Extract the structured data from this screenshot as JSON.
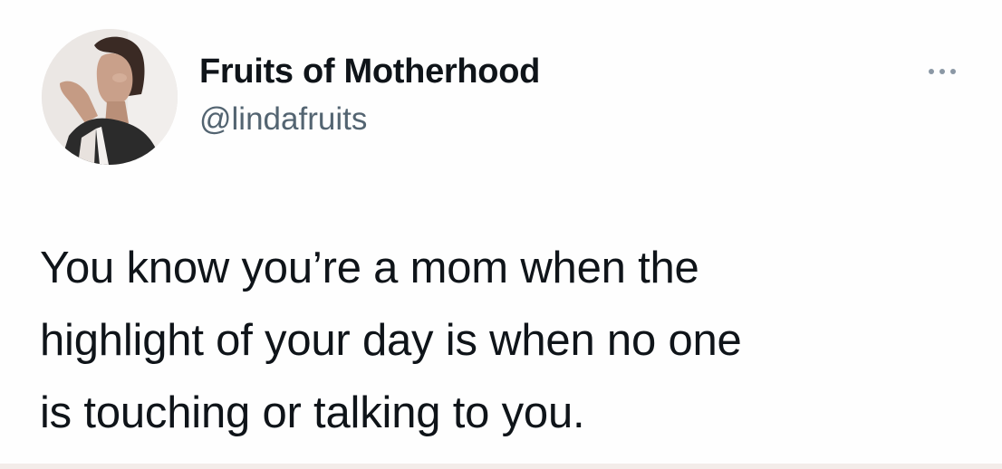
{
  "author": {
    "display_name": "Fruits of Motherhood",
    "handle": "@lindafruits"
  },
  "tweet": {
    "lines": [
      "You know you’re a mom when the",
      "highlight of your day is when no one",
      "is touching or talking to you."
    ]
  },
  "icons": {
    "more": "more-horizontal-icon",
    "avatar": "profile-photo"
  },
  "colors": {
    "text": "#0f1419",
    "secondary_text": "#536471",
    "background": "#ffffff"
  }
}
